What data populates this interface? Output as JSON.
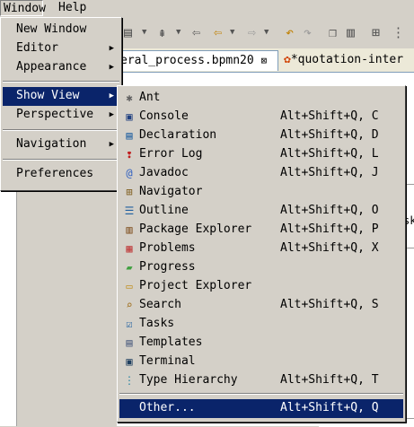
{
  "menubar": {
    "window_label": "Window",
    "help_label": "Help"
  },
  "editor": {
    "tab1_label": "eral_process.bpmn20",
    "tab1_close": "⊠",
    "tab2_label": "*quotation-inter",
    "side_text": "sk"
  },
  "window_menu": {
    "new_window": "New Window",
    "editor": "Editor",
    "appearance": "Appearance",
    "show_view": "Show View",
    "perspective": "Perspective",
    "navigation": "Navigation",
    "preferences": "Preferences"
  },
  "show_view_menu": {
    "items": [
      {
        "label": "Ant",
        "accel": "",
        "icon": "ant-icon",
        "glyph": "✱"
      },
      {
        "label": "Console",
        "accel": "Alt+Shift+Q, C",
        "icon": "console-icon",
        "glyph": "▣"
      },
      {
        "label": "Declaration",
        "accel": "Alt+Shift+Q, D",
        "icon": "declaration-icon",
        "glyph": "▤"
      },
      {
        "label": "Error Log",
        "accel": "Alt+Shift+Q, L",
        "icon": "error-log-icon",
        "glyph": "❢"
      },
      {
        "label": "Javadoc",
        "accel": "Alt+Shift+Q, J",
        "icon": "javadoc-icon",
        "glyph": "@"
      },
      {
        "label": "Navigator",
        "accel": "",
        "icon": "navigator-icon",
        "glyph": "⊞"
      },
      {
        "label": "Outline",
        "accel": "Alt+Shift+Q, O",
        "icon": "outline-icon",
        "glyph": "☰"
      },
      {
        "label": "Package Explorer",
        "accel": "Alt+Shift+Q, P",
        "icon": "package-explorer-icon",
        "glyph": "▥"
      },
      {
        "label": "Problems",
        "accel": "Alt+Shift+Q, X",
        "icon": "problems-icon",
        "glyph": "▦"
      },
      {
        "label": "Progress",
        "accel": "",
        "icon": "progress-icon",
        "glyph": "▰"
      },
      {
        "label": "Project Explorer",
        "accel": "",
        "icon": "project-explorer-icon",
        "glyph": "▭"
      },
      {
        "label": "Search",
        "accel": "Alt+Shift+Q, S",
        "icon": "search-icon",
        "glyph": "⌕"
      },
      {
        "label": "Tasks",
        "accel": "",
        "icon": "tasks-icon",
        "glyph": "☑"
      },
      {
        "label": "Templates",
        "accel": "",
        "icon": "templates-icon",
        "glyph": "▤"
      },
      {
        "label": "Terminal",
        "accel": "",
        "icon": "terminal-icon",
        "glyph": "▣"
      },
      {
        "label": "Type Hierarchy",
        "accel": "Alt+Shift+Q, T",
        "icon": "type-hierarchy-icon",
        "glyph": "⋮"
      },
      {
        "label": "Other...",
        "accel": "Alt+Shift+Q, Q",
        "icon": "",
        "glyph": ""
      }
    ]
  },
  "colors": {
    "menu_bg": "#d4d0c8",
    "selection": "#0a246a",
    "selection_text": "#ffffff"
  }
}
